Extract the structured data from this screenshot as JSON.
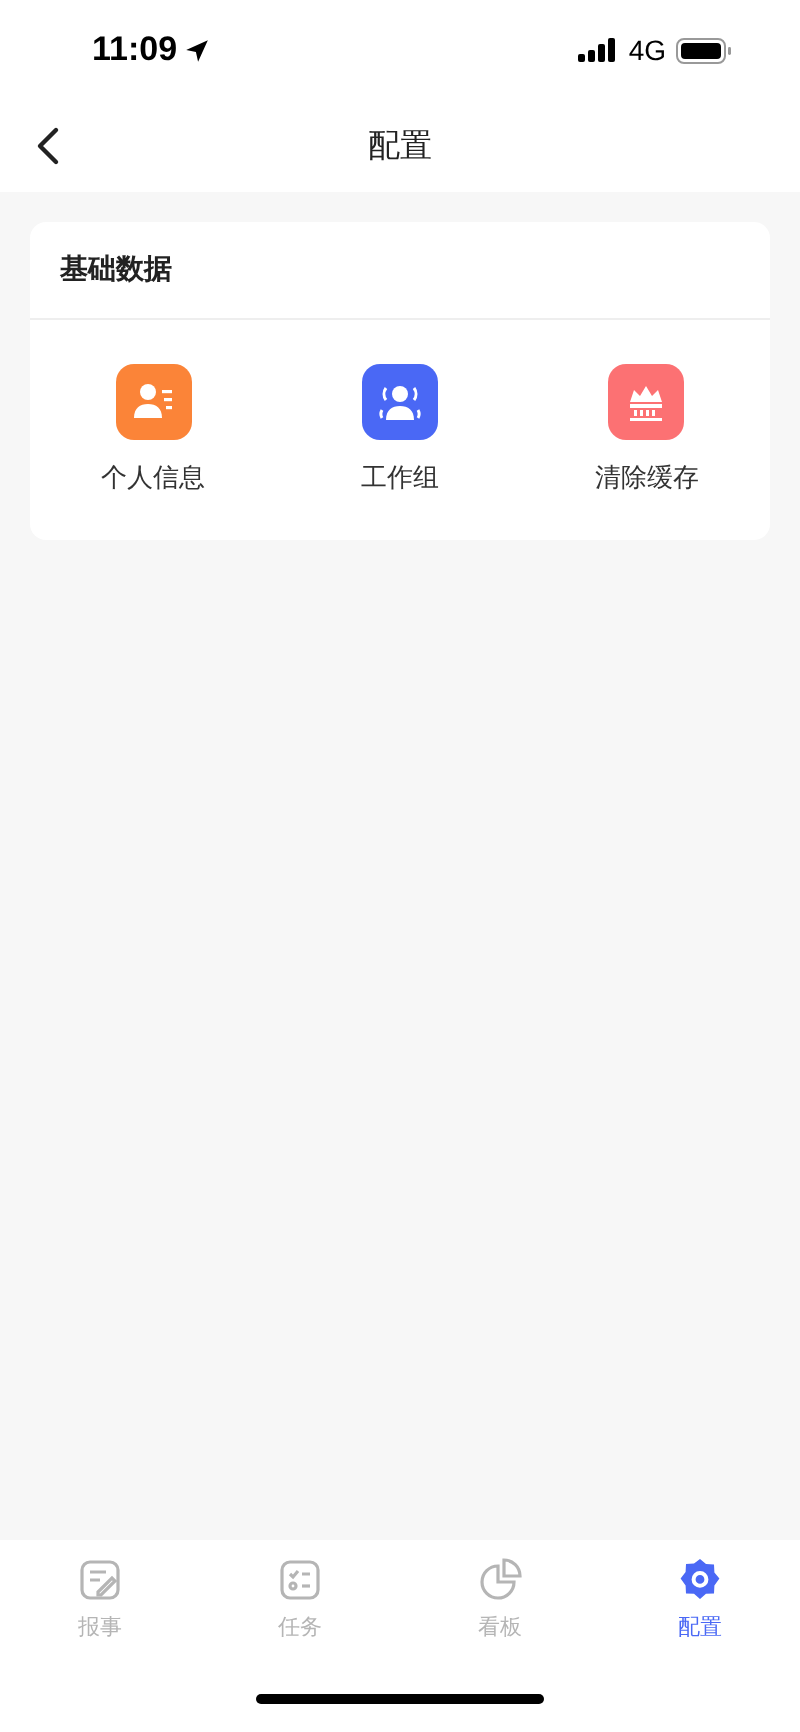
{
  "status_bar": {
    "time": "11:09",
    "network": "4G"
  },
  "nav": {
    "title": "配置"
  },
  "section": {
    "title": "基础数据",
    "items": [
      {
        "label": "个人信息",
        "kind": "profile",
        "color": "#fb8438"
      },
      {
        "label": "工作组",
        "kind": "group",
        "color": "#4a68f5"
      },
      {
        "label": "清除缓存",
        "kind": "clear",
        "color": "#fc7173"
      }
    ]
  },
  "tabs": [
    {
      "label": "报事",
      "kind": "report",
      "selected": false
    },
    {
      "label": "任务",
      "kind": "task",
      "selected": false
    },
    {
      "label": "看板",
      "kind": "board",
      "selected": false
    },
    {
      "label": "配置",
      "kind": "settings",
      "selected": true
    }
  ]
}
